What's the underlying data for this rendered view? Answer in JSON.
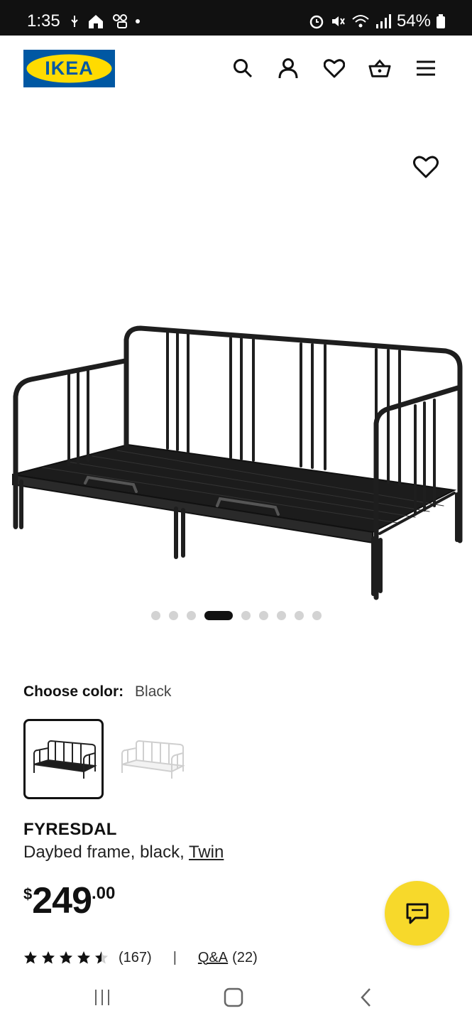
{
  "status_bar": {
    "time": "1:35",
    "battery": "54%",
    "left_icons": [
      "usb-icon",
      "home-icon",
      "voicemail-icon",
      "dot-icon"
    ],
    "right_icons": [
      "alarm-icon",
      "mute-icon",
      "wifi-icon",
      "signal-icon",
      "battery-icon"
    ]
  },
  "header": {
    "logo_text": "IKEA",
    "icons": [
      "search-icon",
      "account-icon",
      "heart-icon",
      "cart-icon",
      "menu-icon"
    ],
    "colors": {
      "logo_blue": "#0058a3",
      "logo_yellow": "#ffdb00"
    }
  },
  "hero": {
    "image": "daybed-black",
    "favorite_icon": "heart-icon",
    "carousel": {
      "total": 9,
      "active_index": 3
    }
  },
  "color_selector": {
    "label": "Choose color:",
    "selected": "Black",
    "swatches": [
      "black-daybed-thumbnail",
      "white-daybed-thumbnail"
    ]
  },
  "product": {
    "name": "FYRESDAL",
    "description": "Daybed frame, black, ",
    "size_link": "Twin",
    "price": {
      "currency": "$",
      "integer": "249",
      "decimal": ".00"
    }
  },
  "ratings": {
    "stars": 4.5,
    "count": "(167)",
    "separator": "|",
    "qa_label": "Q&A",
    "qa_count": "(22)"
  },
  "chat": {
    "icon": "chat-icon",
    "color": "#f7d92b"
  },
  "nav_bar": {
    "buttons": [
      "recents-icon",
      "home-nav-icon",
      "back-icon"
    ]
  }
}
